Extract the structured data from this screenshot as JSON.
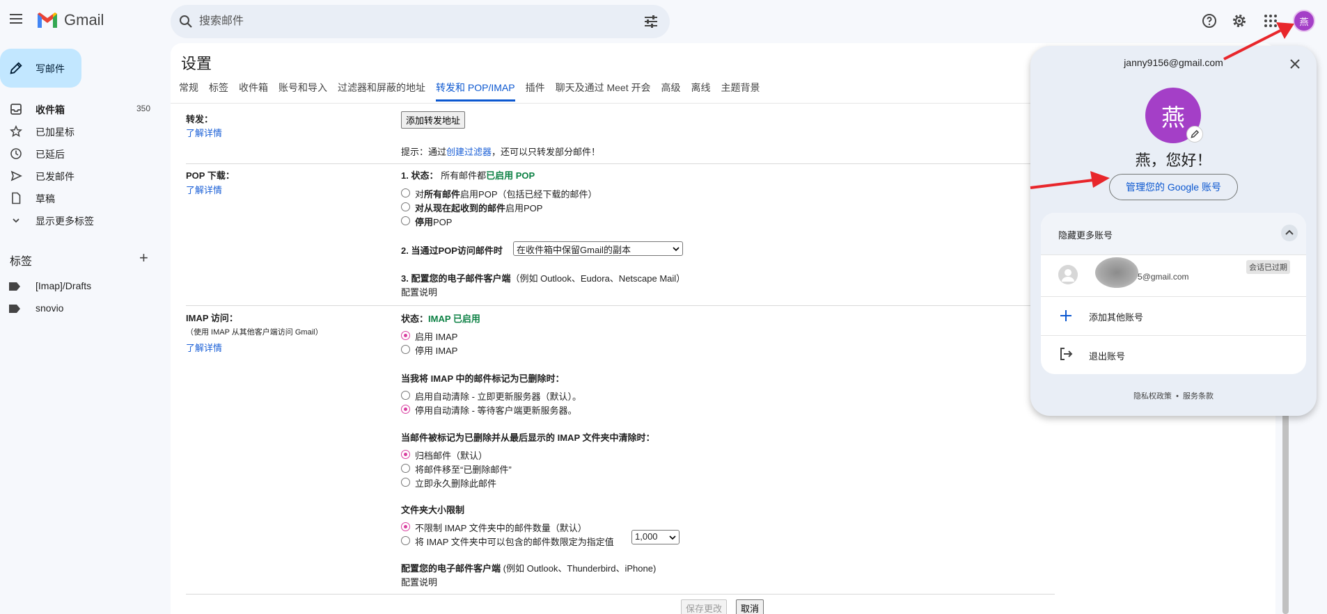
{
  "app": {
    "name": "Gmail"
  },
  "search": {
    "placeholder": "搜索邮件"
  },
  "user": {
    "initial": "燕"
  },
  "sidebar": {
    "compose": "写邮件",
    "items": [
      {
        "label": "收件箱",
        "count": "350",
        "icon": "inbox-icon"
      },
      {
        "label": "已加星标",
        "icon": "star-icon"
      },
      {
        "label": "已延后",
        "icon": "clock-icon"
      },
      {
        "label": "已发邮件",
        "icon": "send-icon"
      },
      {
        "label": "草稿",
        "icon": "draft-icon"
      },
      {
        "label": "显示更多标签",
        "icon": "chevron-down-icon"
      }
    ],
    "labels_title": "标签",
    "labels_add": "+",
    "labels": [
      "[Imap]/Drafts",
      "snovio"
    ]
  },
  "settings": {
    "title": "设置",
    "tabs": [
      "常规",
      "标签",
      "收件箱",
      "账号和导入",
      "过滤器和屏蔽的地址",
      "转发和 POP/IMAP",
      "插件",
      "聊天及通过 Meet 开会",
      "高级",
      "离线",
      "主题背景"
    ],
    "active_tab": "转发和 POP/IMAP",
    "forwarding": {
      "title": "转发：",
      "learn_more": "了解详情",
      "add_button": "添加转发地址",
      "tip_prefix": "提示：通过",
      "tip_link": "创建过滤器",
      "tip_suffix": "，还可以只转发部分邮件！"
    },
    "pop": {
      "title": "POP 下载：",
      "learn_more": "了解详情",
      "status_label": "1. 状态：",
      "status_prefix": "所有邮件都",
      "status_value": "已启用 POP",
      "opt1_prefix": "对",
      "opt1_bold": "所有邮件",
      "opt1_suffix": "启用POP（包括已经下载的邮件）",
      "opt2_bold": "对从现在起收到的邮件",
      "opt2_suffix": "启用POP",
      "opt3_bold": "停用",
      "opt3_suffix": "POP",
      "when_label": "2. 当通过POP访问邮件时",
      "when_value": "在收件箱中保留Gmail的副本",
      "config_label": "3. 配置您的电子邮件客户端",
      "config_hint": "（例如 Outlook、Eudora、Netscape Mail）",
      "config_link": "配置说明"
    },
    "imap": {
      "title": "IMAP 访问：",
      "subtitle": "（使用 IMAP 从其他客户端访问 Gmail）",
      "learn_more": "了解详情",
      "status_label": "状态：",
      "status_value": "IMAP 已启用",
      "enable": "启用 IMAP",
      "disable": "停用 IMAP",
      "deleted_title": "当我将 IMAP 中的邮件标记为已删除时：",
      "deleted_opt1": "启用自动清除 - 立即更新服务器（默认）。",
      "deleted_opt2": "停用自动清除 - 等待客户端更新服务器。",
      "expunge_title": "当邮件被标记为已删除并从最后显示的 IMAP 文件夹中清除时：",
      "expunge_opt1": "归档邮件（默认）",
      "expunge_opt2": "将邮件移至“已删除邮件”",
      "expunge_opt3": "立即永久删除此邮件",
      "folder_title": "文件夹大小限制",
      "folder_opt1": "不限制 IMAP 文件夹中的邮件数量（默认）",
      "folder_opt2": "将 IMAP 文件夹中可以包含的邮件数限定为指定值",
      "folder_limit": "1,000",
      "client_label": "配置您的电子邮件客户端",
      "client_hint": "(例如 Outlook、Thunderbird、iPhone)",
      "client_link": "配置说明"
    },
    "save": "保存更改",
    "cancel": "取消"
  },
  "popup": {
    "email": "janny9156@gmail.com",
    "initial": "燕",
    "greeting": "燕，您好！",
    "manage": "管理您的 Google 账号",
    "hide_more": "隐藏更多账号",
    "other_email": "5@gmail.com",
    "session_badge": "会话已过期",
    "add_account": "添加其他账号",
    "sign_out": "退出账号",
    "privacy": "隐私权政策",
    "dot": "•",
    "terms": "服务条款"
  },
  "colors": {
    "accent": "#0b57d0",
    "compose": "#c2e7ff",
    "avatar": "#a43fc7",
    "arrow": "#e8262b",
    "enabled": "#0b8043"
  }
}
